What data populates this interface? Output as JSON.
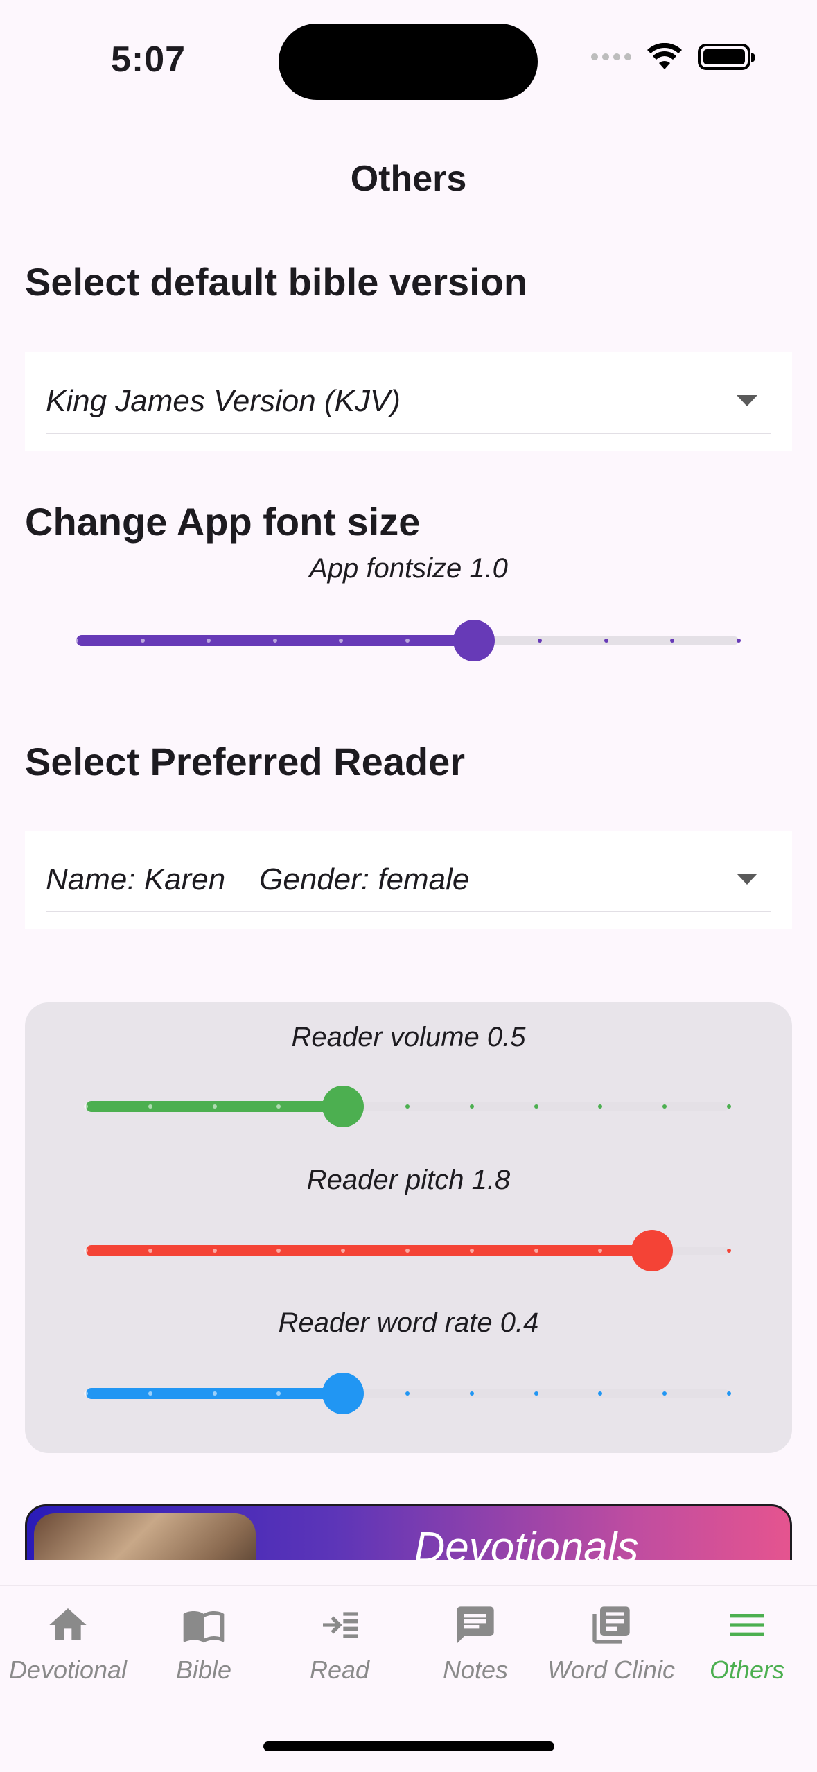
{
  "status_bar": {
    "time": "5:07"
  },
  "page": {
    "title": "Others"
  },
  "bible_version": {
    "heading": "Select default bible version",
    "selected": "King James Version (KJV)"
  },
  "font_size": {
    "heading": "Change App font size",
    "label": "App fontsize 1.0",
    "value_fraction": 0.6,
    "color": "#673ab7"
  },
  "reader": {
    "heading": "Select Preferred Reader",
    "selected": "Name: Karen    Gender: female"
  },
  "reader_controls": {
    "volume": {
      "label": "Reader volume 0.5",
      "value_fraction": 0.4,
      "color": "#4caf50"
    },
    "pitch": {
      "label": "Reader pitch 1.8",
      "value_fraction": 0.88,
      "color": "#f44336"
    },
    "word_rate": {
      "label": "Reader word rate 0.4",
      "value_fraction": 0.4,
      "color": "#2196f3"
    }
  },
  "banner": {
    "title": "Devotionals"
  },
  "bottom_nav": {
    "items": [
      {
        "label": "Devotional",
        "icon": "home-icon"
      },
      {
        "label": "Bible",
        "icon": "book-icon"
      },
      {
        "label": "Read",
        "icon": "read-icon"
      },
      {
        "label": "Notes",
        "icon": "notes-icon"
      },
      {
        "label": "Word Clinic",
        "icon": "library-icon"
      },
      {
        "label": "Others",
        "icon": "menu-icon"
      }
    ],
    "active_color": "#4caf50"
  }
}
